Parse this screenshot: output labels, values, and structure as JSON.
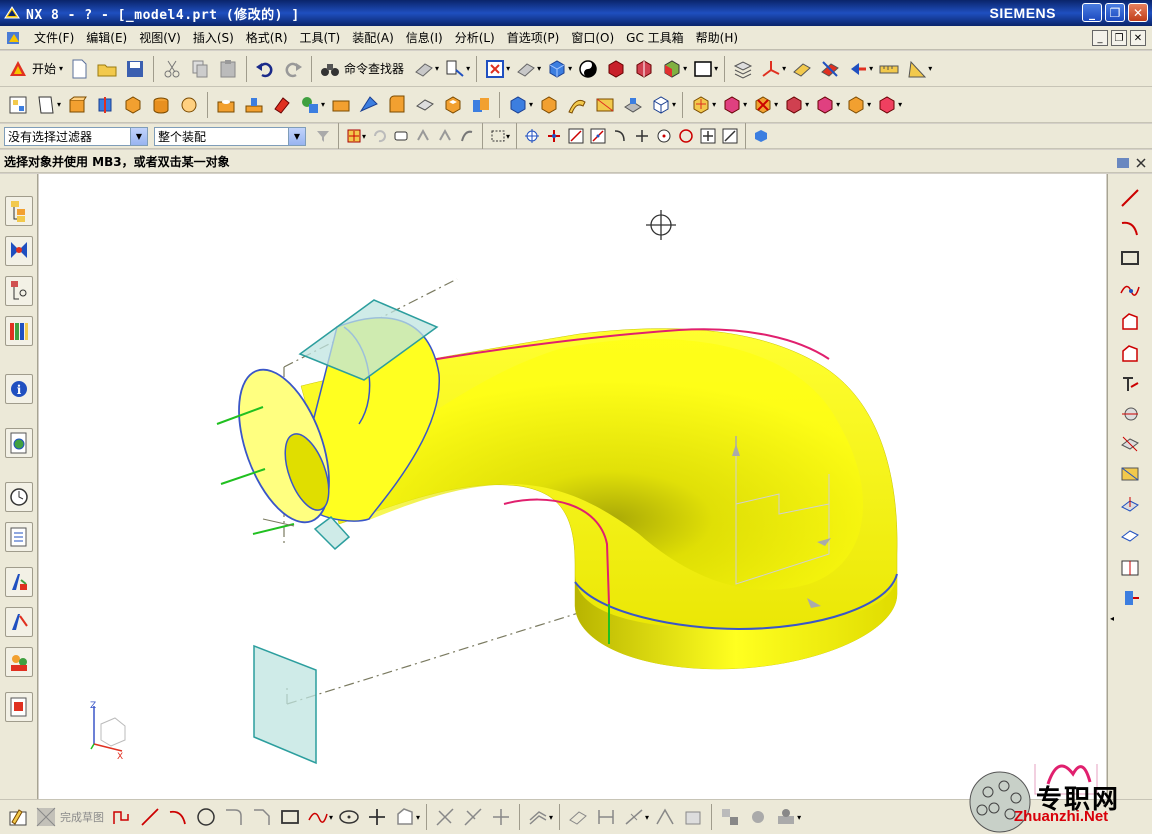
{
  "window": {
    "title": "NX 8 - ? - [_model4.prt  (修改的) ]",
    "brand": "SIEMENS",
    "min_glyph": "_",
    "restore_glyph": "❐",
    "close_glyph": "✕"
  },
  "menubar": {
    "items": [
      "文件(F)",
      "编辑(E)",
      "视图(V)",
      "插入(S)",
      "格式(R)",
      "工具(T)",
      "装配(A)",
      "信息(I)",
      "分析(L)",
      "首选项(P)",
      "窗口(O)",
      "GC 工具箱",
      "帮助(H)"
    ]
  },
  "toolbar": {
    "start_label": "开始",
    "command_finder_label": "命令查找器"
  },
  "selection_bar": {
    "filter_value": "没有选择过滤器",
    "scope_value": "整个装配"
  },
  "cue_line": "选择对象并使用 MB3，或者双击某一对象",
  "sketch_bar": {
    "finish_sketch_label": "完成草图"
  },
  "triad": {
    "z_label": "Z",
    "x_label": "X"
  },
  "watermark": {
    "text": "专职网",
    "site": "Zhuanzhi.Net"
  },
  "colors": {
    "title_bar": "#0a246a",
    "body_fill": "#ffff00",
    "plane_fill": "#bfe4e0",
    "plane_edge": "#2c9e9e",
    "curve_magenta": "#e0206e",
    "curve_blue": "#3a56c8",
    "curve_green": "#20c020"
  }
}
